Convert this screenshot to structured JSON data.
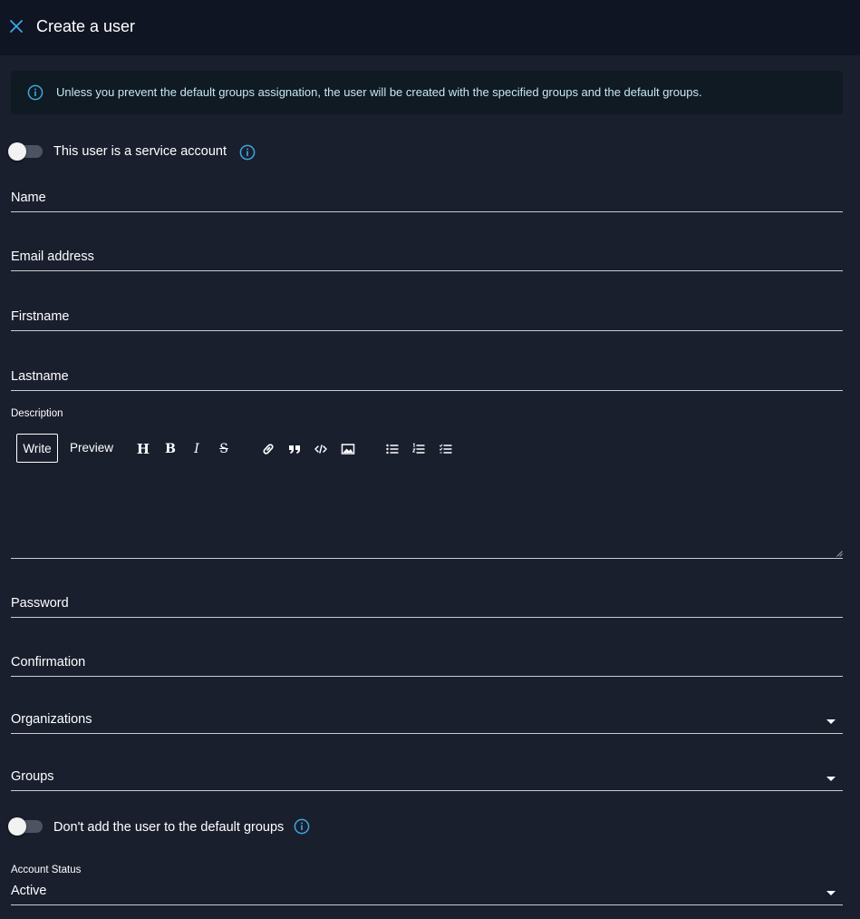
{
  "header": {
    "title": "Create a user"
  },
  "alert": {
    "text": "Unless you prevent the default groups assignation, the user will be created with the specified groups and the default groups."
  },
  "service_account": {
    "label": "This user is a service account",
    "checked": false
  },
  "fields": {
    "name": "Name",
    "email": "Email address",
    "firstname": "Firstname",
    "lastname": "Lastname",
    "password": "Password",
    "confirmation": "Confirmation"
  },
  "description": {
    "label": "Description",
    "write_tab": "Write",
    "preview_tab": "Preview",
    "toolbar": {
      "heading": "H",
      "bold": "B",
      "italic": "I",
      "strike": "S"
    }
  },
  "organizations": {
    "label": "Organizations"
  },
  "groups": {
    "label": "Groups"
  },
  "default_groups": {
    "label": "Don't add the user to the default groups",
    "checked": false
  },
  "account_status": {
    "label": "Account Status",
    "value": "Active"
  },
  "colors": {
    "background": "#1a1f2e",
    "header": "#0f1523",
    "accent": "#3fa7e0",
    "alert_bg": "#0f1a22"
  }
}
